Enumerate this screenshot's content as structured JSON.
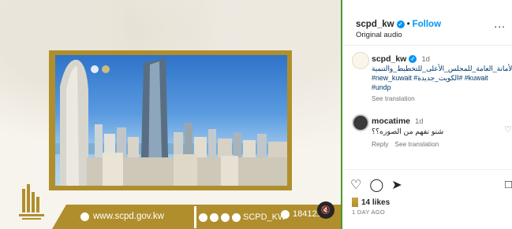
{
  "media": {
    "website": "www.scpd.gov.kw",
    "social_handle": "SCPD_KW",
    "phone": "1841218",
    "colors": {
      "gold": "#b08e2c",
      "divider": "#4c9a2a"
    }
  },
  "post": {
    "username": "scpd_kw",
    "follow_label": "Follow",
    "dot": "•",
    "audio": "Original audio",
    "more_glyph": "..."
  },
  "caption": {
    "username": "scpd_kw",
    "time": "1d",
    "line1": "الأمانة_العامة_للمجلس_الأعلى_للتخطيط_والتنمية#",
    "line2": "#new_kuwait #الكويت_جديدة# #kuwait",
    "line3": "#undp",
    "see_translation": "See translation"
  },
  "comment": {
    "username": "mocatime",
    "time": "1d",
    "text": "شنو نفهم من الصوره؟؟",
    "reply": "Reply",
    "see_translation": "See translation"
  },
  "engagement": {
    "likes": "14 likes",
    "date": "1 DAY AGO"
  },
  "icons": {
    "heart": "heart-icon",
    "comment": "comment-icon",
    "share": "share-icon",
    "bookmark": "bookmark-icon",
    "mute": "speaker-muted-icon"
  }
}
